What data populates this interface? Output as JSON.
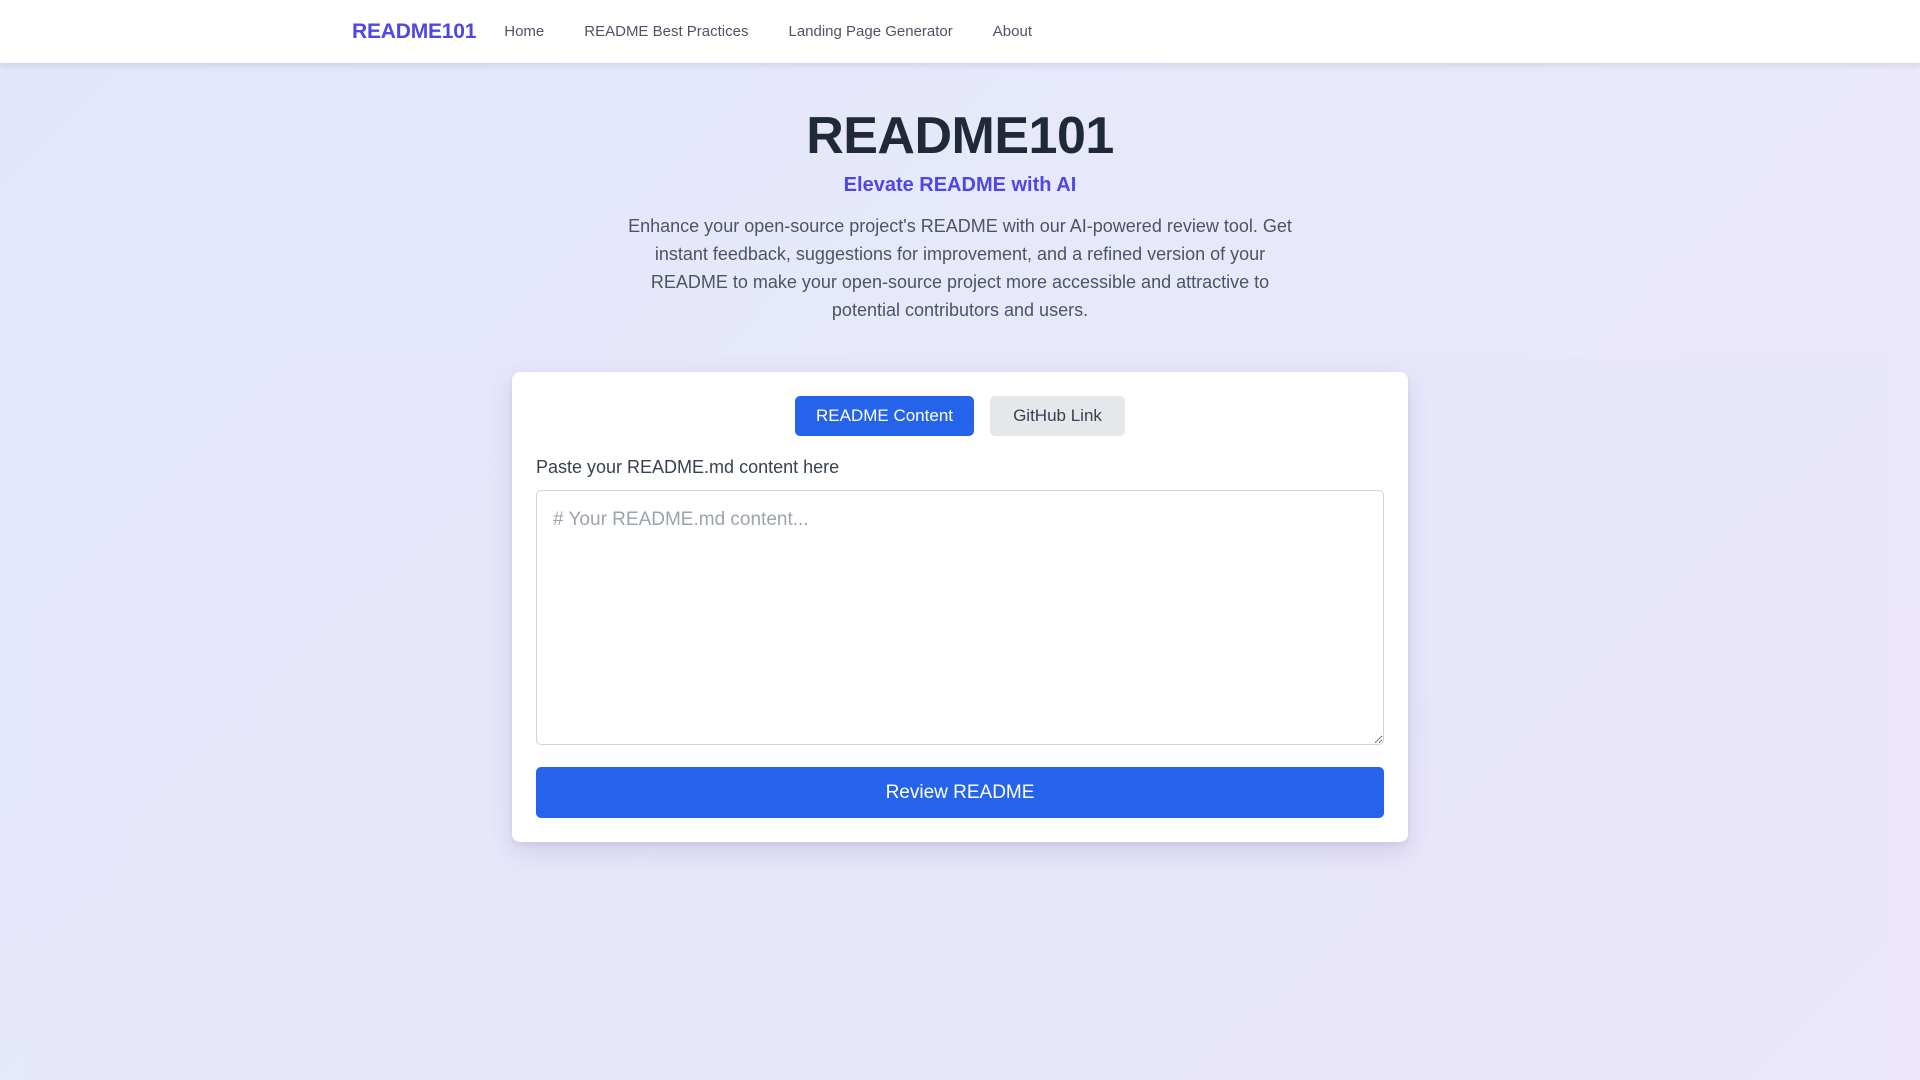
{
  "nav": {
    "brand": "README101",
    "links": [
      {
        "label": "Home"
      },
      {
        "label": "README Best Practices"
      },
      {
        "label": "Landing Page Generator"
      },
      {
        "label": "About"
      }
    ]
  },
  "hero": {
    "title": "README101",
    "subtitle": "Elevate README with AI",
    "description": "Enhance your open-source project's README with our AI-powered review tool. Get instant feedback, suggestions for improvement, and a refined version of your README to make your open-source project more accessible and attractive to potential contributors and users."
  },
  "form": {
    "tabs": [
      {
        "label": "README Content",
        "active": true
      },
      {
        "label": "GitHub Link",
        "active": false
      }
    ],
    "label": "Paste your README.md content here",
    "value": "",
    "placeholder": "# Your README.md content...",
    "submit_label": "Review README"
  },
  "colors": {
    "brand": "#4f46e5",
    "primary": "#2563eb",
    "inactive_tab": "#e5e7eb"
  }
}
